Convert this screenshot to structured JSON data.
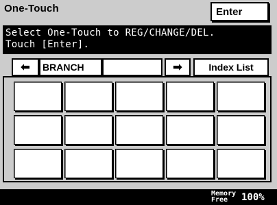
{
  "header": {
    "title": "One-Touch",
    "enter_label": "Enter"
  },
  "message": {
    "line1": "Select One-Touch to REG/CHANGE/DEL.",
    "line2": "Touch [Enter]."
  },
  "tabs": {
    "prev_icon": "left-arrow-icon",
    "prev_glyph": "⬅",
    "current_label": "BRANCH",
    "blank_label": "",
    "next_icon": "right-arrow-icon",
    "next_glyph": "➡",
    "index_label": "Index List"
  },
  "grid": {
    "rows": 3,
    "cols": 5
  },
  "footer": {
    "memory_line1": "Memory",
    "memory_line2": "Free",
    "memory_value": "100%"
  }
}
